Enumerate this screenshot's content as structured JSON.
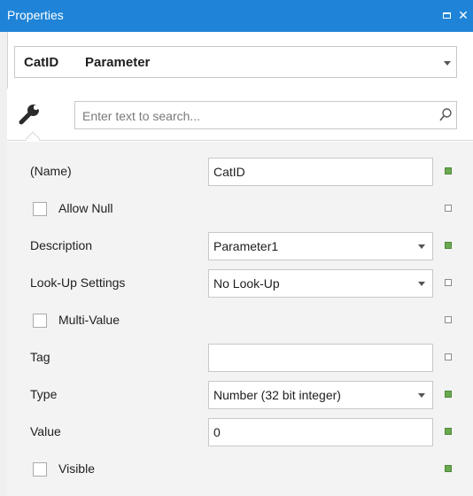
{
  "titlebar": {
    "title": "Properties",
    "close_glyph": "✕",
    "maximize_icon": "maximize-icon",
    "close_icon": "close-icon"
  },
  "object_selector": {
    "name": "CatID",
    "type": "Parameter"
  },
  "toolbar": {
    "tab_icon": "wrench-icon",
    "search_placeholder": "Enter text to search...",
    "search_icon": "search-icon"
  },
  "properties": [
    {
      "label": "(Name)",
      "kind": "text",
      "value": "CatID",
      "state": "set"
    },
    {
      "label": "Allow Null",
      "kind": "checkbox",
      "checked": false,
      "state": "default"
    },
    {
      "label": "Description",
      "kind": "dropdown",
      "value": "Parameter1",
      "state": "set"
    },
    {
      "label": "Look-Up Settings",
      "kind": "dropdown",
      "value": "No Look-Up",
      "state": "default"
    },
    {
      "label": "Multi-Value",
      "kind": "checkbox",
      "checked": false,
      "state": "default"
    },
    {
      "label": "Tag",
      "kind": "text",
      "value": "",
      "state": "default"
    },
    {
      "label": "Type",
      "kind": "dropdown",
      "value": "Number (32 bit integer)",
      "state": "set"
    },
    {
      "label": "Value",
      "kind": "text",
      "value": "0",
      "state": "set"
    },
    {
      "label": "Visible",
      "kind": "checkbox",
      "checked": false,
      "state": "set"
    }
  ],
  "colors": {
    "titlebar": "#1f84d8",
    "marker_set": "#6aa84f",
    "grid_background": "#f3f3f3"
  }
}
